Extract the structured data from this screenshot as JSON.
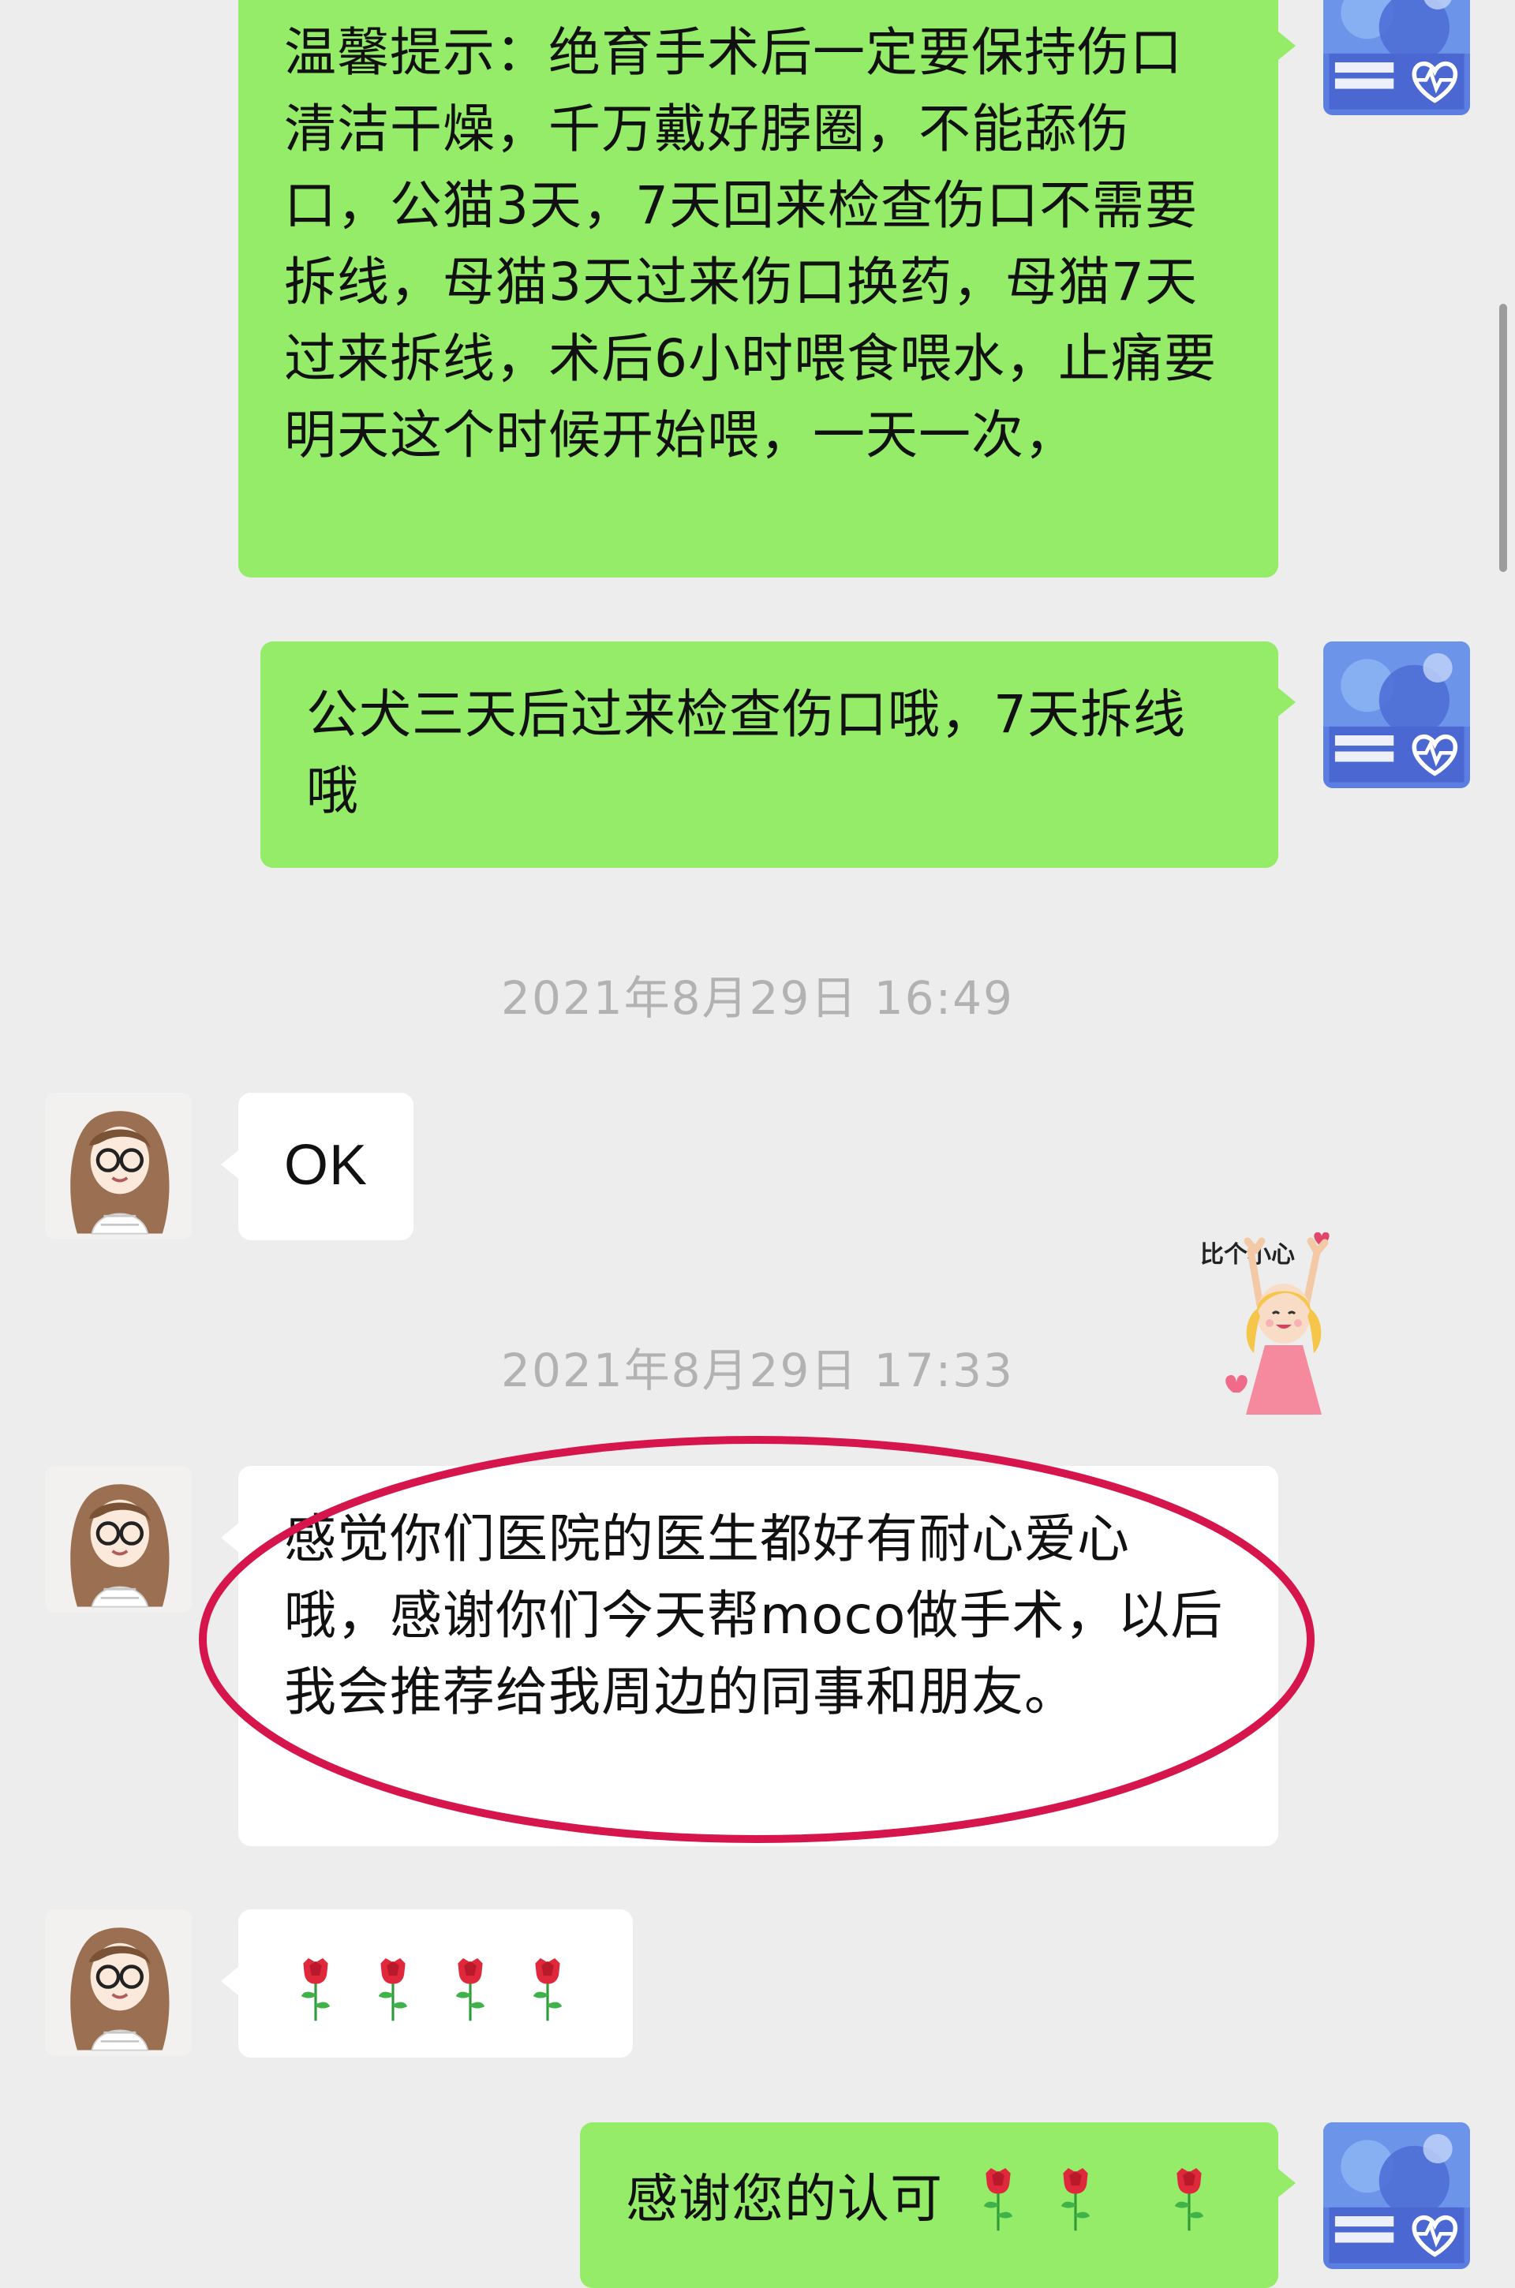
{
  "messages": [
    {
      "id": "m1",
      "sender": "hospital",
      "text": "温馨提示：绝育手术后一定要保持伤口清洁干燥，千万戴好脖圈，不能舔伤口，公猫3天，7天回来检查伤口不需要拆线，母猫3天过来伤口换药，母猫7天过来拆线，术后6小时喂食喂水，止痛要明天这个时候开始喂，一天一次，"
    },
    {
      "id": "m2",
      "sender": "hospital",
      "text": "公犬三天后过来检查伤口哦，7天拆线哦"
    },
    {
      "id": "m3",
      "sender": "customer",
      "text": "OK"
    },
    {
      "id": "m4",
      "sender": "customer",
      "text": "感觉你们医院的医生都好有耐心爱心哦，感谢你们今天帮moco做手术，以后我会推荐给我周边的同事和朋友。"
    },
    {
      "id": "m5",
      "sender": "customer",
      "emoji": [
        "rose",
        "rose",
        "rose",
        "rose"
      ]
    },
    {
      "id": "m6",
      "sender": "hospital",
      "text": "感谢您的认可",
      "emoji": [
        "rose",
        "rose",
        "rose"
      ]
    }
  ],
  "timestamps": [
    "2021年8月29日 16:49",
    "2021年8月29日 17:33"
  ],
  "sticker": {
    "name": "heart-gesture-girl-sticker",
    "caption": "比个小心"
  },
  "icons": {
    "hospital_avatar": "hospital-avatar-icon",
    "customer_avatar": "customer-avatar-icon",
    "rose": "rose-icon",
    "highlight": "red-ellipse-highlight"
  },
  "colors": {
    "background": "#ededed",
    "outgoing_bubble": "#95ec69",
    "incoming_bubble": "#ffffff",
    "timestamp_text": "#b2b2b2",
    "highlight_ellipse": "#d5154b"
  }
}
